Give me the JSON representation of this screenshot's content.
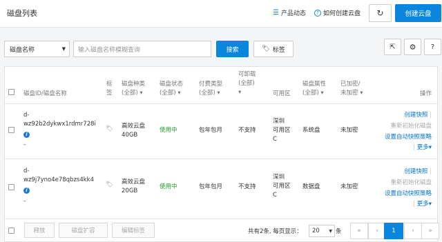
{
  "header": {
    "title": "磁盘列表",
    "product_news": "产品动态",
    "how_to_create": "如何创建云盘",
    "create_button": "创建云盘"
  },
  "filter": {
    "select_value": "磁盘名称",
    "search_placeholder": "输入磁盘名称模糊查询",
    "search_button": "搜索",
    "tag_button": "标签"
  },
  "table": {
    "headers": {
      "disk_id": "磁盘ID/磁盘名称",
      "tag": "标签",
      "type_line1": "磁盘种类",
      "type_line2": "(全部)",
      "status_line1": "磁盘状态",
      "status_line2": "(全部)",
      "billing_line1": "付费类型",
      "billing_line2": "(全部)",
      "detach_line1": "可卸载",
      "detach_line2": "(全部)",
      "zone": "可用区",
      "attr_line1": "磁盘属性",
      "attr_line2": "(全部)",
      "enc_line1": "已加密/",
      "enc_line2": "未加密",
      "ops": "操作"
    },
    "rows": [
      {
        "id_line1": "d-",
        "id_line2": "wz92b2dykwx1rdmr728i",
        "name": "-",
        "type_line1": "高效云盘",
        "type_line2": "40GB",
        "status": "使用中",
        "billing": "包年包月",
        "detach": "不支持",
        "zone_line1": "深圳",
        "zone_line2": "可用区",
        "zone_line3": "C",
        "attr": "系统盘",
        "enc": "未加密",
        "op_snapshot": "创建快照",
        "op_reinit": "重新初始化磁盘",
        "op_policy": "设置自动快照策略",
        "op_more": "更多"
      },
      {
        "id_line1": "d-",
        "id_line2": "wz9j7yno4e78qbzs4kk4",
        "name": "-",
        "type_line1": "高效云盘",
        "type_line2": "20GB",
        "status": "使用中",
        "billing": "包年包月",
        "detach": "不支持",
        "zone_line1": "深圳",
        "zone_line2": "可用区",
        "zone_line3": "C",
        "attr": "数据盘",
        "enc": "未加密",
        "op_snapshot": "创建快照",
        "op_reinit": "重新初始化磁盘",
        "op_policy": "设置自动快照策略",
        "op_more": "更多"
      }
    ]
  },
  "footer": {
    "release": "释放",
    "expand": "磁盘扩容",
    "edit_tags": "编辑标签",
    "summary": "共有2条, 每页显示：",
    "page_size": "20",
    "unit": "条",
    "first": "«",
    "prev": "‹",
    "current_page": "1",
    "next": "›",
    "last": "»"
  },
  "colors": {
    "accent": "#0a86de",
    "status_green": "#1f9b26",
    "link": "#0073d4"
  }
}
